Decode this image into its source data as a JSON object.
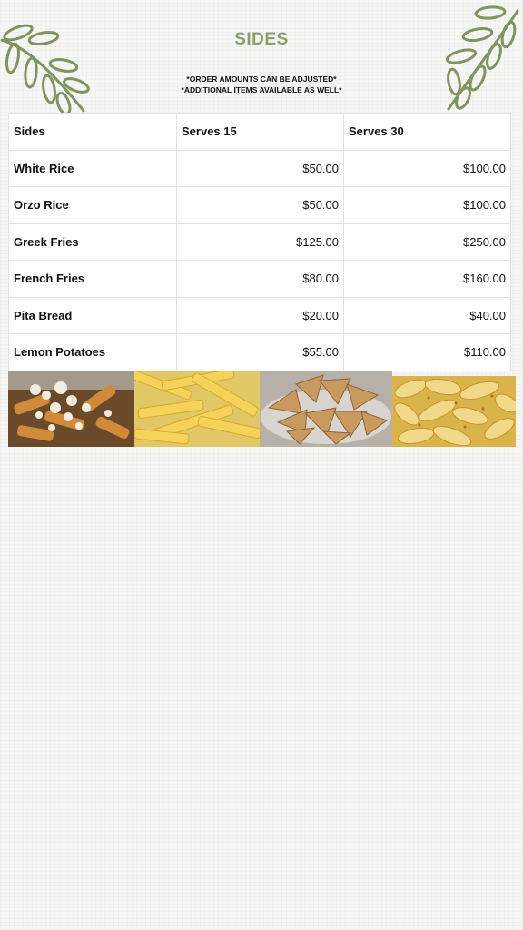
{
  "page": {
    "title": "SIDES"
  },
  "notes": [
    "*ORDER AMOUNTS CAN BE ADJUSTED*",
    "*ADDITIONAL ITEMS AVAILABLE AS WELL*"
  ],
  "table": {
    "headers": [
      "Sides",
      "Serves 15",
      "Serves 30"
    ],
    "rows": [
      {
        "name": "White Rice",
        "serves15": "$50.00",
        "serves30": "$100.00"
      },
      {
        "name": "Orzo Rice",
        "serves15": "$50.00",
        "serves30": "$100.00"
      },
      {
        "name": "Greek Fries",
        "serves15": "$125.00",
        "serves30": "$250.00"
      },
      {
        "name": "French Fries",
        "serves15": "$80.00",
        "serves30": "$160.00"
      },
      {
        "name": "Pita Bread",
        "serves15": "$20.00",
        "serves30": "$40.00"
      },
      {
        "name": "Lemon Potatoes",
        "serves15": "$55.00",
        "serves30": "$110.00"
      }
    ]
  },
  "colors": {
    "accent_green": "#8aa06a",
    "leaf_green": "#7e9560"
  },
  "photos": [
    "greek-fries-photo",
    "french-fries-photo",
    "pita-bread-photo",
    "lemon-potatoes-photo"
  ]
}
